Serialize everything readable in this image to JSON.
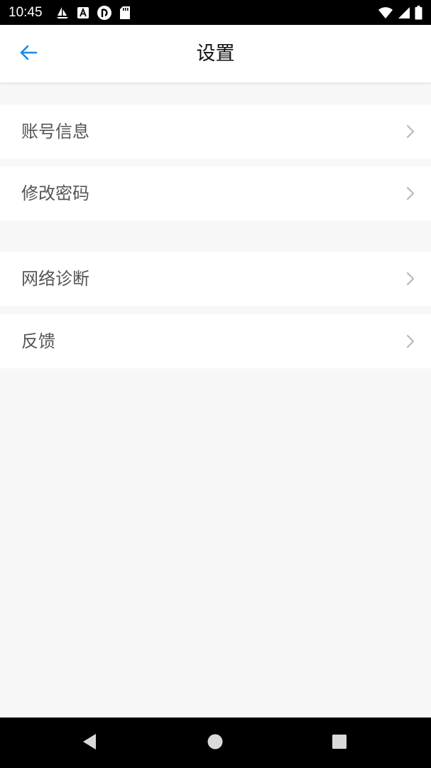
{
  "status_bar": {
    "time": "10:45",
    "left_icons": [
      "sailboat-icon",
      "app-a-icon",
      "pocket-casts-icon",
      "sd-card-icon"
    ],
    "right_icons": [
      "wifi-icon",
      "cell-signal-icon",
      "battery-icon"
    ]
  },
  "header": {
    "title": "设置",
    "back_icon": "arrow-left-icon"
  },
  "settings": {
    "groups": [
      {
        "items": [
          {
            "label": "账号信息",
            "icon": "chevron-right-icon"
          },
          {
            "label": "修改密码",
            "icon": "chevron-right-icon"
          }
        ]
      },
      {
        "items": [
          {
            "label": "网络诊断",
            "icon": "chevron-right-icon"
          },
          {
            "label": "反馈",
            "icon": "chevron-right-icon"
          }
        ]
      }
    ]
  },
  "nav_bar": {
    "buttons": [
      "back-triangle-icon",
      "home-circle-icon",
      "recents-square-icon"
    ]
  },
  "colors": {
    "accent": "#1e88e5",
    "background": "#f7f7f7",
    "row_background": "#ffffff",
    "label_text": "#555555",
    "title_text": "#111111",
    "chevron": "#b8b8b8",
    "system_bars": "#000000"
  }
}
